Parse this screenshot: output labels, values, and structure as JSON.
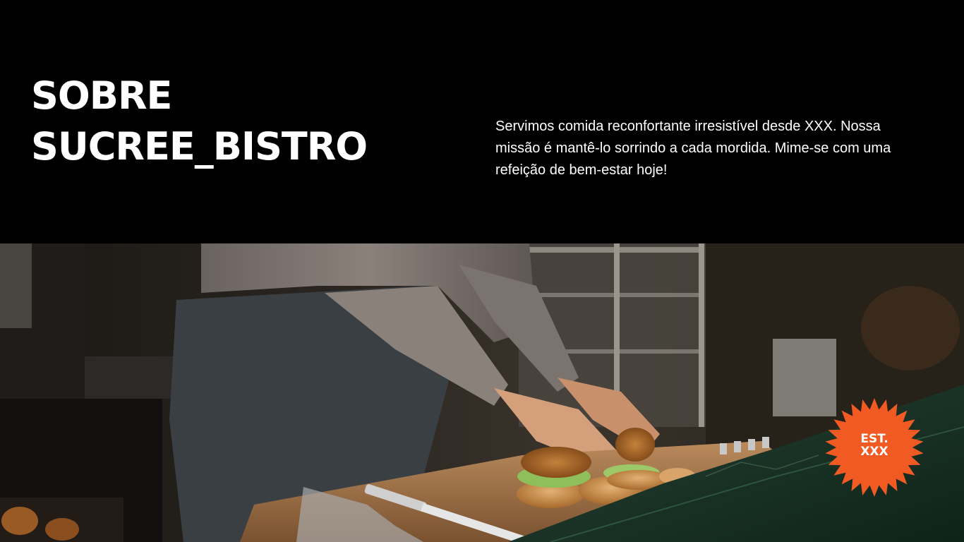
{
  "header": {
    "title_line1": "SOBRE",
    "title_line2": "SUCREE_BISTRO",
    "description": "Servimos comida reconfortante irresistível desde XXX. Nossa missão é mantê-lo sorrindo a cada mordida. Mime-se com uma refeição de bem-estar hoje!"
  },
  "badge": {
    "line1": "EST.",
    "line2": "XXX",
    "color": "#f15a22"
  },
  "colors": {
    "background": "#000000",
    "text": "#ffffff",
    "countertop": "#1d3a2c"
  }
}
